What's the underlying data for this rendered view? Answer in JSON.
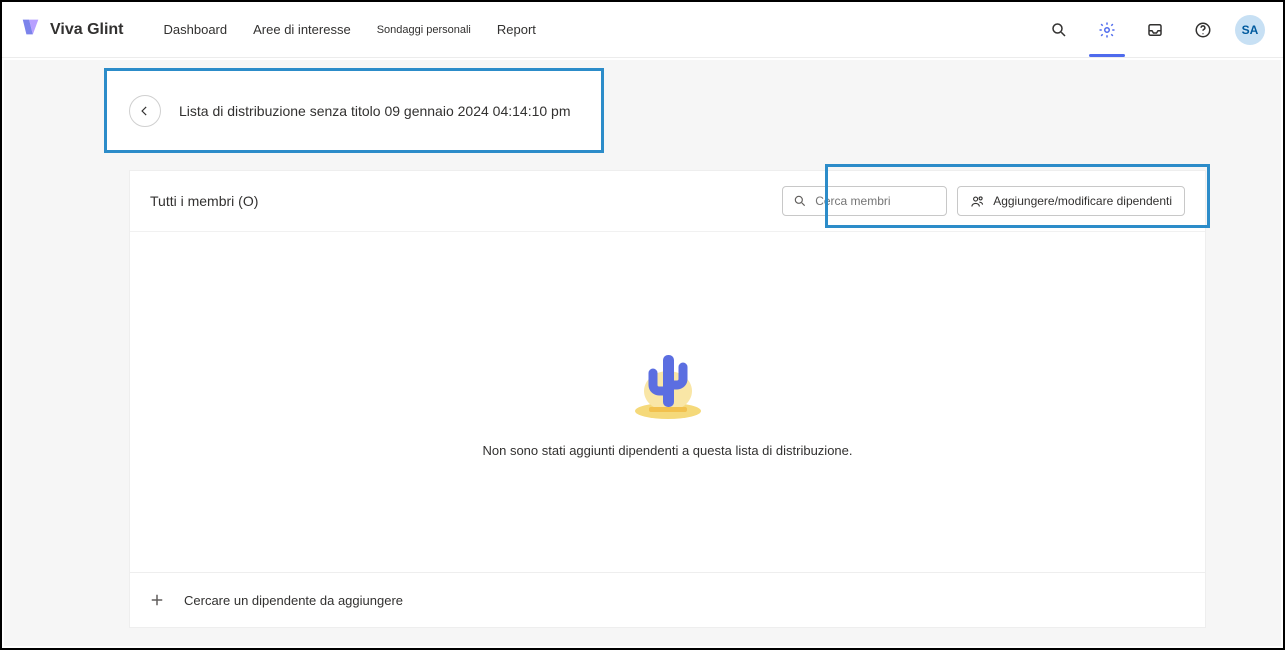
{
  "header": {
    "product_name": "Viva Glint",
    "nav": {
      "dashboard": "Dashboard",
      "focus": "Aree di interesse",
      "surveys": "Sondaggi personali",
      "reports": "Report"
    },
    "avatar_initials": "SA"
  },
  "page": {
    "title": "Lista di distribuzione senza titolo 09 gennaio 2024 04:14:10 pm"
  },
  "members_panel": {
    "all_members_label": "Tutti i membri (O)",
    "search_placeholder": "Cerca membri",
    "add_employees_label": "Aggiungere/modificare dipendenti",
    "empty_message": "Non sono stati aggiunti dipendenti a questa lista di distribuzione.",
    "footer_text": "Cercare un dipendente da aggiungere"
  }
}
